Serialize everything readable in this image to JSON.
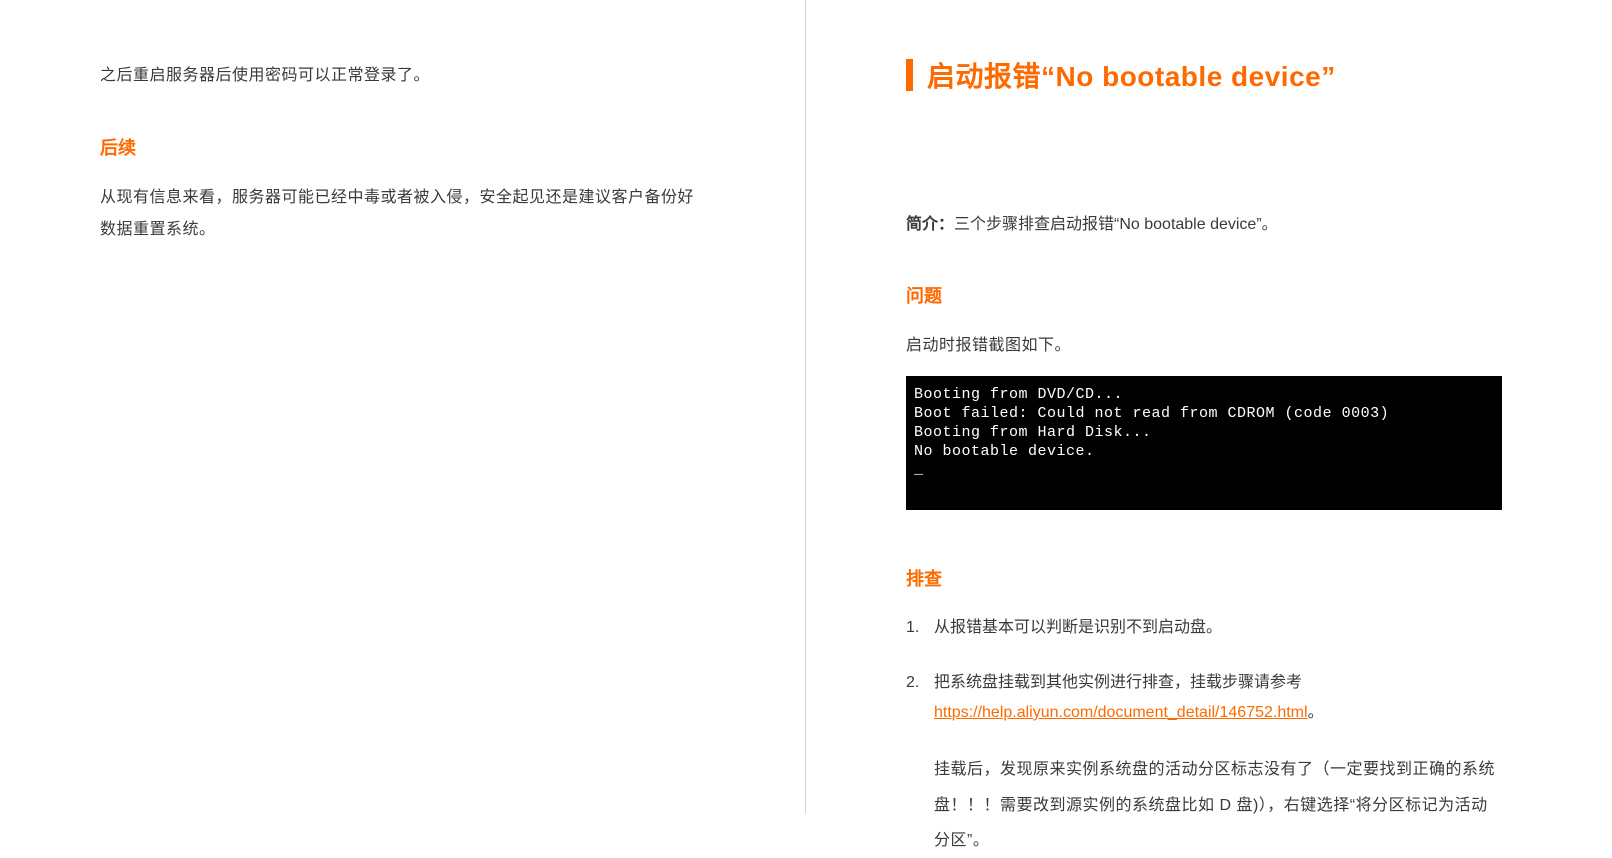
{
  "left": {
    "para1": "之后重启服务器后使用密码可以正常登录了。",
    "heading1": "后续",
    "para2": "从现有信息来看，服务器可能已经中毒或者被入侵，安全起见还是建议客户备份好数据重置系统。"
  },
  "right": {
    "chapter_title": "启动报错“No bootable device”",
    "intro_label": "简介：",
    "intro_text": "三个步骤排查启动报错“No bootable device”。",
    "heading_problem": "问题",
    "problem_text": "启动时报错截图如下。",
    "terminal": "Booting from DVD/CD...\nBoot failed: Could not read from CDROM (code 0003)\nBooting from Hard Disk...\nNo bootable device.\n_",
    "heading_investigate": "排查",
    "steps": {
      "s1_num": "1.",
      "s1_text": "从报错基本可以判断是识别不到启动盘。",
      "s2_num": "2.",
      "s2_text_before": "把系统盘挂载到其他实例进行排查，挂载步骤请参考 ",
      "s2_link": "https://help.aliyun.com/document_detail/146752.html",
      "s2_text_after": "。",
      "s2_para": "挂载后，发现原来实例系统盘的活动分区标志没有了（一定要找到正确的系统盘！！！需要改到源实例的系统盘比如 D 盘)），右键选择“将分区标记为活动分区”。"
    }
  }
}
